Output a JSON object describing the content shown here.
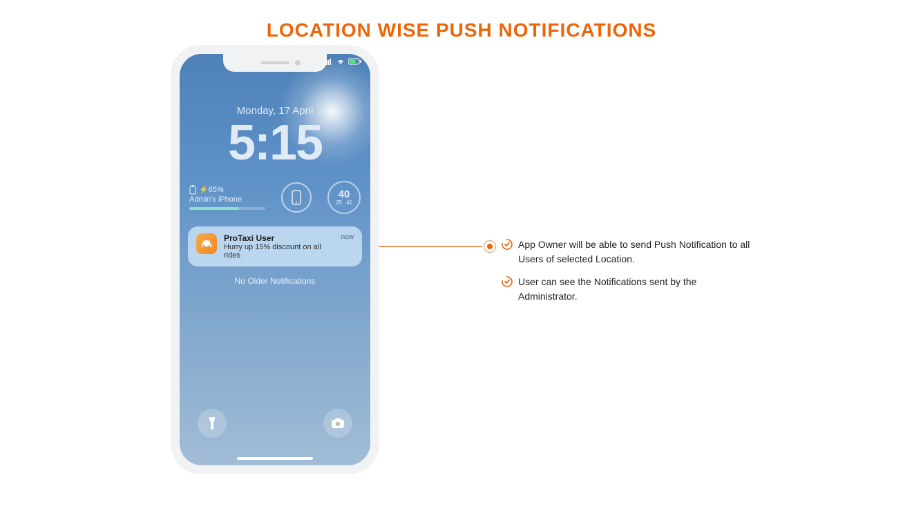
{
  "page": {
    "title": "LOCATION WISE PUSH NOTIFICATIONS"
  },
  "lockscreen": {
    "date": "Monday, 17 April",
    "time": "5:15",
    "battery_percent": "65%",
    "battery_prefix": "⚡",
    "device_name": "Admin's iPhone",
    "weather_temp": "40",
    "weather_low": "25",
    "weather_high": "41",
    "no_older": "No Older Notifications"
  },
  "notification": {
    "app_name": "ProTaxi User",
    "message": "Hurry up 15% discount on all rides",
    "time": "now"
  },
  "features": [
    "App Owner will be able to send Push Notification to all Users of selected Location.",
    "User can see the Notifications sent by the Administrator."
  ],
  "colors": {
    "accent": "#ec6608"
  }
}
